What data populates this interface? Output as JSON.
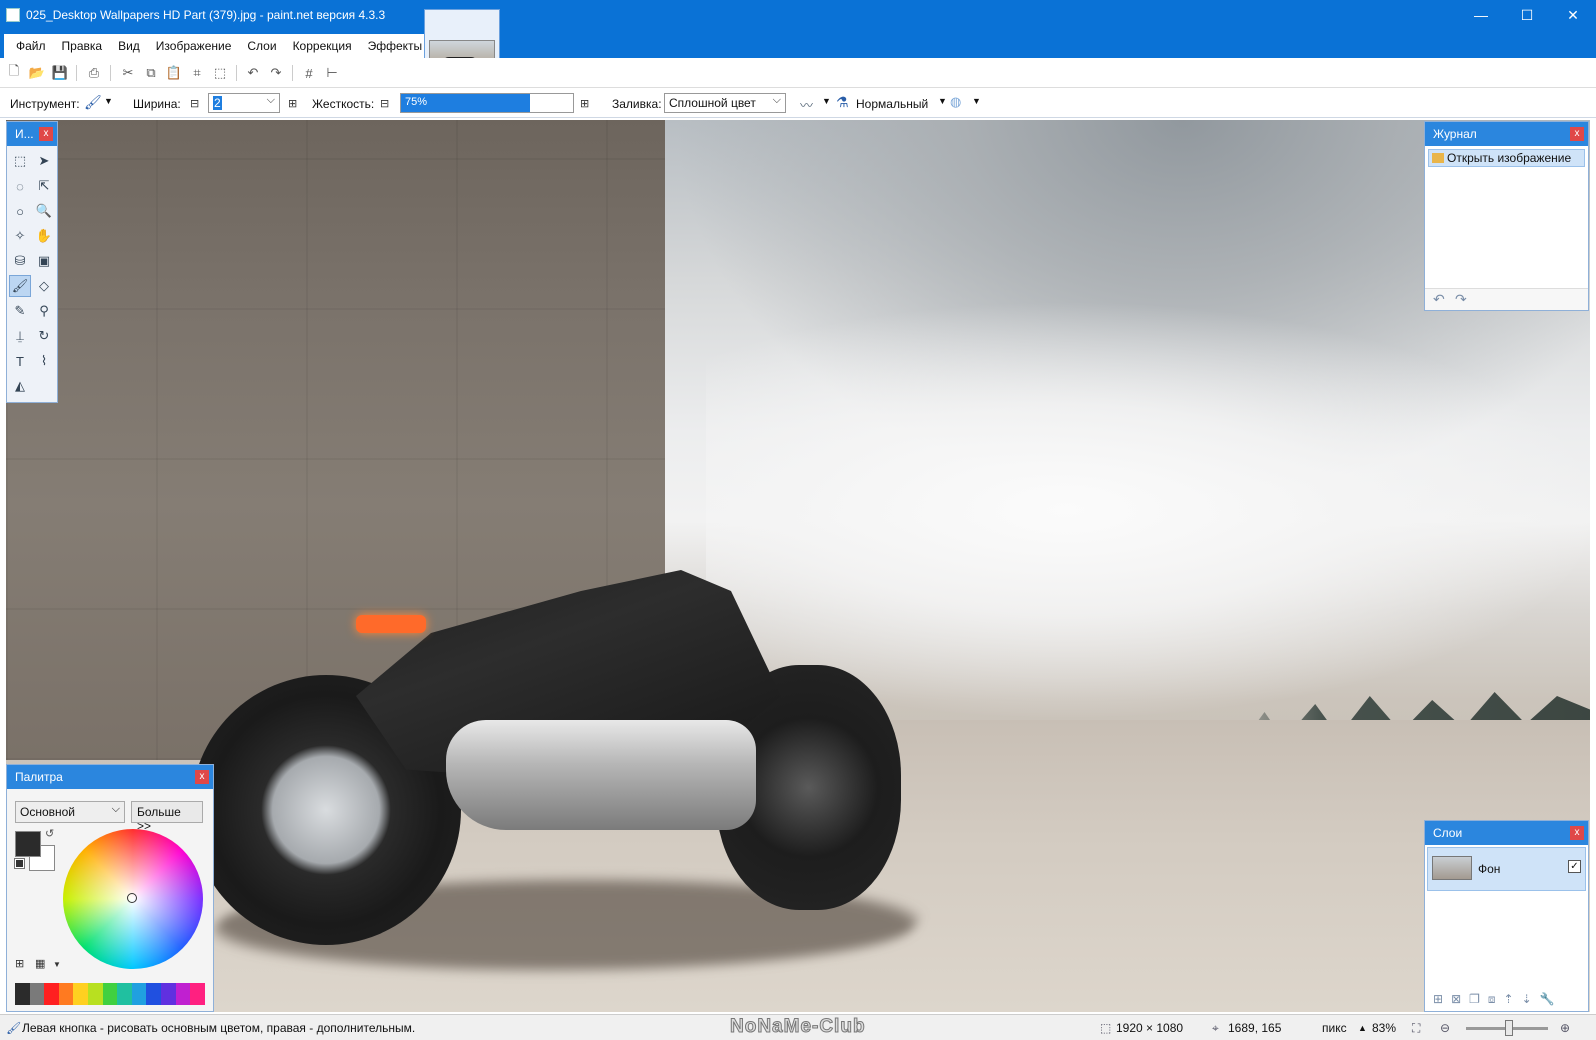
{
  "window": {
    "title": "025_Desktop Wallpapers  HD Part (379).jpg - paint.net версия 4.3.3",
    "minimize": "—",
    "maximize": "☐",
    "close": "✕"
  },
  "menu": [
    "Файл",
    "Правка",
    "Вид",
    "Изображение",
    "Слои",
    "Коррекция",
    "Эффекты"
  ],
  "options": {
    "tool_label": "Инструмент:",
    "width_label": "Ширина:",
    "width_value": "2",
    "hardness_label": "Жесткость:",
    "hardness_value": "75%",
    "hardness_fraction": 0.75,
    "fill_label": "Заливка:",
    "fill_value": "Сплошной цвет",
    "blend_mode": "Нормальный",
    "minus": "⊟",
    "plus": "⊞"
  },
  "panels": {
    "tools": {
      "title": "И..."
    },
    "history": {
      "title": "Журнал",
      "items": [
        "Открыть изображение"
      ]
    },
    "palette": {
      "title": "Палитра",
      "preset": "Основной",
      "more_button": "Больше >>",
      "primary_color": "#2b2b2b",
      "secondary_color": "#ffffff",
      "swatches": [
        "#2b2b2b",
        "#7a7a7a",
        "#ff2020",
        "#ff7a20",
        "#ffd020",
        "#b8e020",
        "#40d040",
        "#20c0a0",
        "#20a0e0",
        "#2050e0",
        "#6030e0",
        "#c020d0",
        "#ff2080"
      ]
    },
    "layers": {
      "title": "Слои",
      "items": [
        {
          "name": "Фон",
          "visible": "✓"
        }
      ]
    }
  },
  "statusbar": {
    "hint": "Левая кнопка - рисовать основным цветом, правая - дополнительным.",
    "watermark": "NoNaMe-Club",
    "image_size": "1920 × 1080",
    "cursor_pos": "1689, 165",
    "units": "пикс",
    "zoom": "83%"
  },
  "colors": {
    "accent": "#0a72d6",
    "panel_head": "#2b86de"
  }
}
